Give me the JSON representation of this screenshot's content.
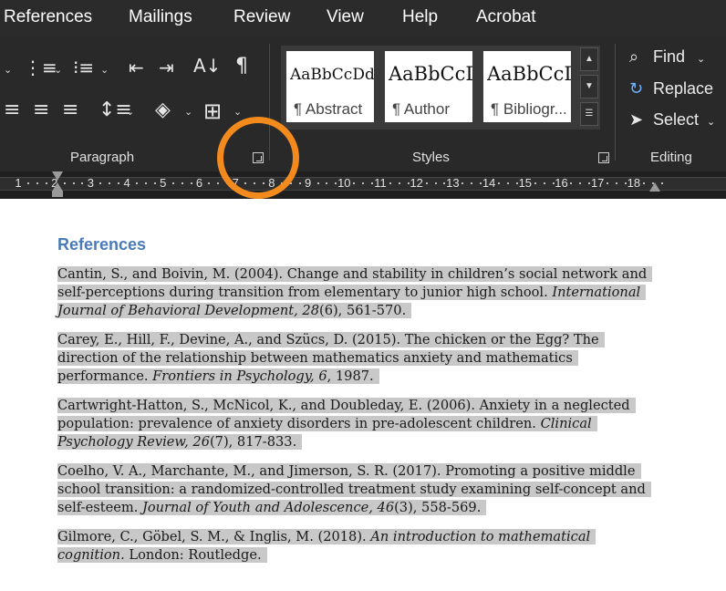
{
  "tabs": [
    "References",
    "Mailings",
    "Review",
    "View",
    "Help",
    "Acrobat"
  ],
  "ribbon": {
    "paragraph_label": "Paragraph",
    "styles_label": "Styles",
    "editing_label": "Editing",
    "styles": [
      {
        "sample": "AaBbCcDd",
        "name": "¶ Abstract"
      },
      {
        "sample": "AaBbCcD",
        "name": "¶ Author"
      },
      {
        "sample": "AaBbCcD",
        "name": "¶ Bibliogr..."
      }
    ],
    "editing": {
      "find": "Find",
      "replace": "Replace",
      "select": "Select"
    },
    "icons": {
      "pilcrow": "¶"
    }
  },
  "ruler": {
    "numbers": [
      "1",
      "2",
      "3",
      "4",
      "5",
      "6",
      "7",
      "8",
      "9",
      "10",
      "11",
      "12",
      "13",
      "14",
      "15",
      "16",
      "17",
      "18"
    ]
  },
  "document": {
    "heading": "References",
    "refs": [
      {
        "plain": "Cantin, S., and Boivin, M. (2004). Change and stability in children’s social network and self-perceptions during transition from elementary to junior high school. ",
        "italic": "International Journal of Behavioral Development, 28",
        "tail": "(6), 561-570."
      },
      {
        "plain": "Carey, E., Hill, F., Devine, A., and Szücs, D. (2015). The chicken or the Egg? The direction of the relationship between mathematics anxiety and mathematics performance. ",
        "italic": "Frontiers in Psychology, 6",
        "tail": ", 1987."
      },
      {
        "plain": "Cartwright-Hatton, S., McNicol, K., and Doubleday, E. (2006). Anxiety in a neglected population: prevalence of anxiety disorders in pre-adolescent children. ",
        "italic": "Clinical Psychology Review, 26",
        "tail": "(7), 817-833."
      },
      {
        "plain": "Coelho, V. A., Marchante, M., and Jimerson, S. R. (2017). Promoting a positive middle school transition: a randomized-controlled treatment study examining self-concept and self-esteem. ",
        "italic": "Journal of Youth and Adolescence, 46",
        "tail": "(3), 558-569."
      },
      {
        "plain": "Gilmore, C., Göbel, S. M., & Inglis, M. (2018). ",
        "italic": "An introduction to mathematical cognition.",
        "tail": " London: Routledge."
      }
    ]
  }
}
